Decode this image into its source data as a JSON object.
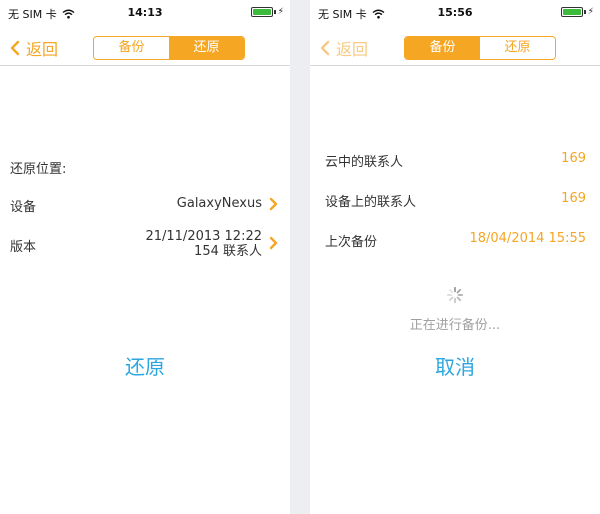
{
  "left": {
    "status": {
      "carrier": "无 SIM 卡",
      "time": "14:13"
    },
    "nav": {
      "back_label": "返回",
      "tabs": [
        "备份",
        "还原"
      ],
      "active_tab": "还原"
    },
    "section_title": "还原位置:",
    "device": {
      "label": "设备",
      "value": "GalaxyNexus"
    },
    "version": {
      "label": "版本",
      "date": "21/11/2013 12:22",
      "contacts": "154 联系人"
    },
    "action_label": "还原"
  },
  "right": {
    "status": {
      "carrier": "无 SIM 卡",
      "time": "15:56"
    },
    "nav": {
      "back_label": "返回",
      "tabs": [
        "备份",
        "还原"
      ],
      "active_tab": "备份"
    },
    "cloud_contacts": {
      "label": "云中的联系人",
      "value": "169"
    },
    "device_contacts": {
      "label": "设备上的联系人",
      "value": "169"
    },
    "last_backup": {
      "label": "上次备份",
      "value": "18/04/2014 15:55"
    },
    "progress_text": "正在进行备份...",
    "cancel_label": "取消"
  },
  "colors": {
    "accent": "#f5a623",
    "link": "#2ca6e0",
    "battery": "#3dbb3d"
  },
  "icons": [
    "wifi-icon",
    "battery-icon",
    "chevron-left-icon",
    "chevron-right-icon",
    "spinner-icon"
  ]
}
